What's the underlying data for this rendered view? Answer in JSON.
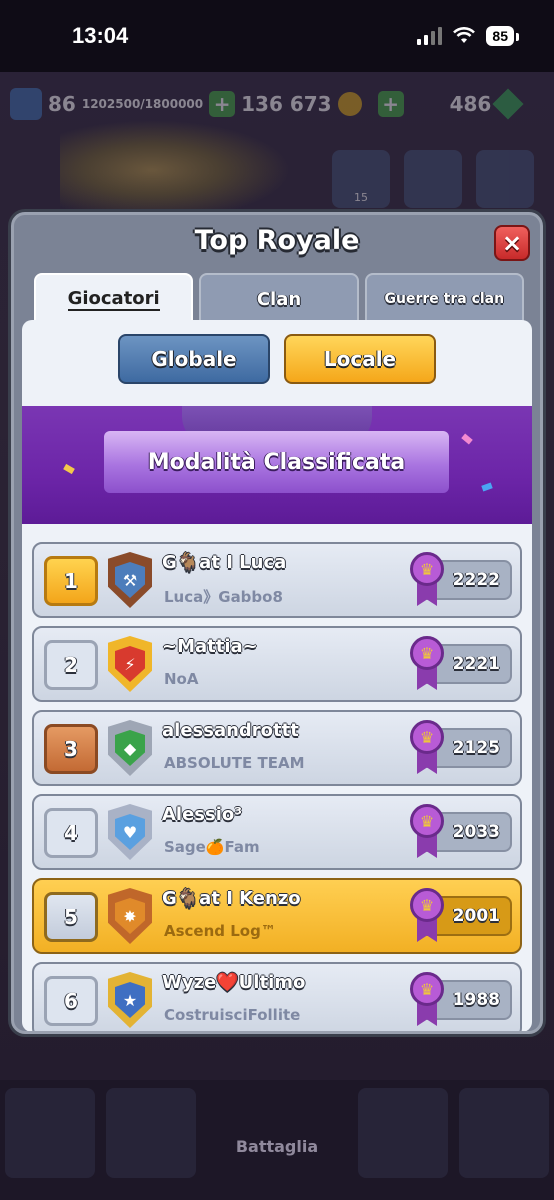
{
  "status_bar": {
    "time": "13:04",
    "battery": "85"
  },
  "resources": {
    "level": "86",
    "xp": "1202500/1800000",
    "gold": "136 673",
    "gems": "486"
  },
  "background": {
    "clan_count": "15",
    "battle_label": "Battaglia"
  },
  "modal": {
    "title": "Top Royale",
    "close_icon": "×",
    "tabs": [
      {
        "label": "Giocatori",
        "active": true
      },
      {
        "label": "Clan",
        "active": false
      },
      {
        "label": "Guerre tra clan",
        "active": false
      }
    ],
    "scope_buttons": {
      "global": "Globale",
      "local": "Locale"
    },
    "banner_title": "Modalità Classificata"
  },
  "leaderboard": [
    {
      "rank": "1",
      "name": "G🐐at I Luca",
      "clan": "Luca》Gabbo8",
      "trophies": "2222",
      "badge_icon": "hammer-icon",
      "badge_color": "#8a4b2a",
      "rank_style": "gold",
      "highlight": false
    },
    {
      "rank": "2",
      "name": "~Mattia~",
      "clan": "NoA",
      "trophies": "2221",
      "badge_icon": "lightning-icon",
      "badge_color": "#f0b62a",
      "rank_style": "plain",
      "highlight": false
    },
    {
      "rank": "3",
      "name": "alessandrottt",
      "clan": "ABSOLUTE TEAM",
      "trophies": "2125",
      "badge_icon": "gem-icon",
      "badge_color": "#9ea6b5",
      "rank_style": "bronze",
      "highlight": false
    },
    {
      "rank": "4",
      "name": "Alessio³",
      "clan": "Sage🍊Fam",
      "trophies": "2033",
      "badge_icon": "heart-icon",
      "badge_color": "#a9b2c6",
      "rank_style": "plain",
      "highlight": false
    },
    {
      "rank": "5",
      "name": "G🐐at I Kenzo",
      "clan": "Ascend Log™",
      "trophies": "2001",
      "badge_icon": "star-burst-icon",
      "badge_color": "#c0672a",
      "rank_style": "hl",
      "highlight": true
    },
    {
      "rank": "6",
      "name": "Wyze❤️Ultimo",
      "clan": "CostruisciFollite",
      "trophies": "1988",
      "badge_icon": "star-icon",
      "badge_color": "#e3b334",
      "rank_style": "plain",
      "highlight": false
    }
  ]
}
